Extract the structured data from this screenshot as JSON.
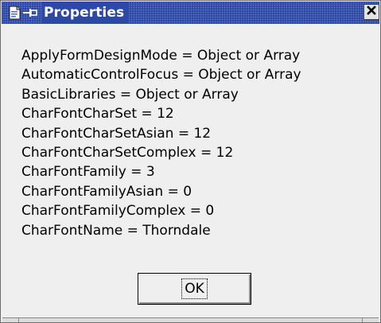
{
  "window": {
    "title": "Properties",
    "title_bar_color": "#2c49a6",
    "icons": [
      "document-icon",
      "pin-icon",
      "close-icon"
    ]
  },
  "properties": [
    {
      "text": "ApplyFormDesignMode = Object or Array"
    },
    {
      "text": "AutomaticControlFocus = Object or Array"
    },
    {
      "text": "BasicLibraries = Object or Array"
    },
    {
      "text": "CharFontCharSet = 12"
    },
    {
      "text": "CharFontCharSetAsian = 12"
    },
    {
      "text": "CharFontCharSetComplex = 12"
    },
    {
      "text": "CharFontFamily = 3"
    },
    {
      "text": "CharFontFamilyAsian = 0"
    },
    {
      "text": "CharFontFamilyComplex = 0"
    },
    {
      "text": "CharFontName = Thorndale"
    }
  ],
  "buttons": {
    "ok_label": "OK"
  }
}
